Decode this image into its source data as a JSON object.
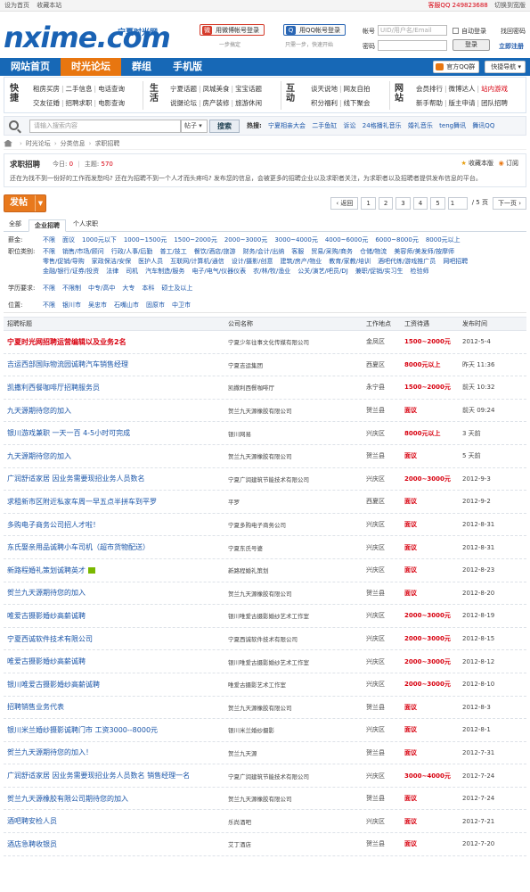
{
  "topbar": {
    "set_home": "设为首页",
    "bookmark": "收藏本站",
    "qq_group": "客服QQ 249823688",
    "switch_version": "切换到宽版"
  },
  "brand": {
    "logo": "nxime.com",
    "logo_cn": "宁夏时光网"
  },
  "login": {
    "weibo_label": "用微博帐号登录",
    "weibo_sub": "一步搞定",
    "qq_label": "用QQ帐号登录",
    "qq_sub": "只需一步，快速开始",
    "account_label": "帐号",
    "account_placeholder": "UID/用户名/Email",
    "auto_login": "自动登录",
    "forgot": "找回密码",
    "password_label": "密码",
    "login_button": "登录",
    "register": "立即注册"
  },
  "nav": {
    "items": [
      {
        "label": "网站首页"
      },
      {
        "label": "时光论坛"
      },
      {
        "label": "群组"
      },
      {
        "label": "手机版"
      }
    ],
    "qq_group": "官方QQ群",
    "quick_nav": "快捷导航"
  },
  "quicklinks": {
    "s1_title": "快捷",
    "s1_row1": [
      "租房买房",
      "二手信息",
      "电话查询"
    ],
    "s1_row2": [
      "交友征婚",
      "招聘求职",
      "电影查询"
    ],
    "s2_title": "生活",
    "s2_row1": [
      "宁夏话题",
      "凤城美食",
      "宝宝话题"
    ],
    "s2_row2": [
      "说摄论坛",
      "房产装修",
      "旅游休闲"
    ],
    "s3_title": "互动",
    "s3_row1": [
      "谈天说地",
      "网友自拍"
    ],
    "s3_row2": [
      "积分福利",
      "线下聚会"
    ],
    "s4_title": "网站",
    "s4_row1": [
      "会员排行",
      "微博达人",
      "站内游戏"
    ],
    "s4_row2": [
      "新手帮助",
      "版主申请",
      "团队招聘"
    ]
  },
  "search": {
    "placeholder": "请输入搜索内容",
    "scope": "帖子",
    "button": "搜索",
    "hot_label": "热搜:",
    "hot": [
      "宁夏相亲大会",
      "二手鱼缸",
      "诉讼",
      "24格播礼音乐",
      "婚礼音乐",
      "teng舞讯",
      "舞讯QQ"
    ]
  },
  "breadcrumb": [
    "时光论坛",
    "分类信息",
    "求职招聘"
  ],
  "forum": {
    "title": "求职招聘",
    "today_label": "今日:",
    "today": "0",
    "topics_label": "主题:",
    "topics": "570",
    "favorite": "收藏本版",
    "rss": "订阅",
    "desc": "还在为找不到一份好的工作而发愁吗? 还在为招聘不到一个人才而头疼吗? 发布您的信息，会被更多的招聘企业以及求职者关注，为求职者以及招聘者提供发布信息的平台。"
  },
  "toolbar": {
    "post": "发帖",
    "post_dd": "▼"
  },
  "pager": {
    "prev": "‹ 返回",
    "pages": [
      "1",
      "2",
      "3",
      "4",
      "5"
    ],
    "current": "1",
    "total": "/ 5 页",
    "next": "下一页 ›"
  },
  "tabs": [
    {
      "label": "全部"
    },
    {
      "label": "企业招聘"
    },
    {
      "label": "个人求职"
    }
  ],
  "filters": {
    "salary_label": "薪金:",
    "salary": [
      "不限",
      "面议",
      "1000元以下",
      "1000~1500元",
      "1500~2000元",
      "2000~3000元",
      "3000~4000元",
      "4000~6000元",
      "6000~8000元",
      "8000元以上"
    ],
    "job_label": "职位类别:",
    "job_row1": [
      "不限",
      "销售/市场/顾问",
      "行政/人事/后勤",
      "普工/技工",
      "餐饮/酒店/旅游",
      "财务/会计/出纳",
      "客服",
      "贸易/采购/商务",
      "仓储/物流",
      "美容师/美发师/按摩师"
    ],
    "job_row2": [
      "零售/促销/导购",
      "家政保洁/安保",
      "医护人员",
      "互联网/计算机/通信",
      "设计/摄影/创意",
      "建筑/房产/物业",
      "教育/家教/培训",
      "酒吧代练/游戏推广员",
      "网吧招聘"
    ],
    "job_row3": [
      "金融/银行/证券/投资",
      "法律",
      "司机",
      "汽车制造/服务",
      "电子/电气/仪器仪表",
      "农/林/牧/渔业",
      "公关/演艺/吧员/DJ",
      "兼职/促销/实习生",
      "检验师"
    ],
    "edu_label": "学历要求:",
    "edu": [
      "不限",
      "不限制",
      "中专/高中",
      "大专",
      "本科",
      "硕士及以上"
    ],
    "loc_label": "位置:",
    "loc": [
      "不限",
      "银川市",
      "吴忠市",
      "石嘴山市",
      "固原市",
      "中卫市"
    ]
  },
  "table": {
    "headers": [
      "招聘标题",
      "公司名称",
      "工作地点",
      "工资待遇",
      "发布时间"
    ],
    "rows": [
      [
        "宁夏时光网招聘运营编辑以及业务2名",
        "宁夏少年往事文化传媒有限公司",
        "金凤区",
        "1500~2000元",
        "2012-5-4"
      ],
      [
        "吉运西部国际物流园诚聘汽车销售经理",
        "宁夏吉运集团",
        "西夏区",
        "8000元以上",
        "昨天 11:36"
      ],
      [
        "凯撒利西餐咖啡厅招聘服务员",
        "凯撒利西餐咖啡厅",
        "永宁县",
        "1500~2000元",
        "前天 10:32"
      ],
      [
        "九天源期待您的加入",
        "贺兰九天源橡胶有限公司",
        "贺兰县",
        "面议",
        "前天 09:24"
      ],
      [
        "银川游戏兼职 一天一百 4-5小时可完成",
        "银川网易",
        "兴庆区",
        "8000元以上",
        "3 天前"
      ],
      [
        "九天源期待您的加入",
        "贺兰九天源橡胶有限公司",
        "贺兰县",
        "面议",
        "5 天前"
      ],
      [
        "广润舒适家居 因业务需要现招业务人员数名",
        "宁夏广润建筑节能技术有限公司",
        "兴庆区",
        "2000~3000元",
        "2012-9-3"
      ],
      [
        "求租新市区附近私家车周一早五点半拼车到平罗",
        "平罗",
        "西夏区",
        "面议",
        "2012-9-2"
      ],
      [
        "多购电子商务公司招人才啦！",
        "宁夏多购电子商务公司",
        "兴庆区",
        "面议",
        "2012-8-31"
      ],
      [
        "东氏娶亲用品诚聘小车司机（超市货物配送）",
        "宁夏东氏号婆",
        "兴庆区",
        "面议",
        "2012-8-31"
      ],
      [
        "新路程婚礼策划诚聘英才",
        "新路程婚礼策划",
        "兴庆区",
        "面议",
        "2012-8-23"
      ],
      [
        "贺兰九天源期待您的加入",
        "贺兰九天源橡胶有限公司",
        "贺兰县",
        "面议",
        "2012-8-20"
      ],
      [
        "唯爱古摄影婚纱高薪诚聘",
        "银川唯爱古摄影婚纱艺术工作室",
        "兴庆区",
        "2000~3000元",
        "2012-8-19"
      ],
      [
        "宁夏西诚软件技术有限公司",
        "宁夏西诚软件技术有限公司",
        "兴庆区",
        "2000~3000元",
        "2012-8-15"
      ],
      [
        "唯爱古摄影婚纱高薪诚聘",
        "银川唯爱古摄影婚纱艺术工作室",
        "兴庆区",
        "2000~3000元",
        "2012-8-12"
      ],
      [
        "银川唯爱古摄影婚纱高薪诚聘",
        "唯爱古摄影艺术工作室",
        "兴庆区",
        "2000~3000元",
        "2012-8-10"
      ],
      [
        "招聘销售业务代表",
        "贺兰九天源橡胶有限公司",
        "贺兰县",
        "面议",
        "2012-8-3"
      ],
      [
        "银川米兰婚纱摄影诚聘门市 工资3000--8000元",
        "银川米兰婚纱摄影",
        "兴庆区",
        "面议",
        "2012-8-1"
      ],
      [
        "贺兰九天源期待您的加入！",
        "贺兰九天源",
        "贺兰县",
        "面议",
        "2012-7-31"
      ],
      [
        "广润舒适家居 因业务需要现招业务人员数名 销售经理一名",
        "宁夏广润建筑节能技术有限公司",
        "兴庆区",
        "3000~4000元",
        "2012-7-24"
      ],
      [
        "贺兰九天源橡胶有限公司期待您的加入",
        "贺兰九天源橡胶有限公司",
        "贺兰县",
        "面议",
        "2012-7-24"
      ],
      [
        "酒吧聘安检人员",
        "乐尚酒吧",
        "兴庆区",
        "面议",
        "2012-7-21"
      ],
      [
        "酒店急聘收银员",
        "艾丁酒店",
        "贺兰县",
        "面议",
        "2012-7-20"
      ]
    ]
  },
  "colors": {
    "brand_blue": "#1768b6",
    "active_orange": "#e87610",
    "highlight_red": "#d8000f",
    "link_blue": "#1a55a8"
  }
}
